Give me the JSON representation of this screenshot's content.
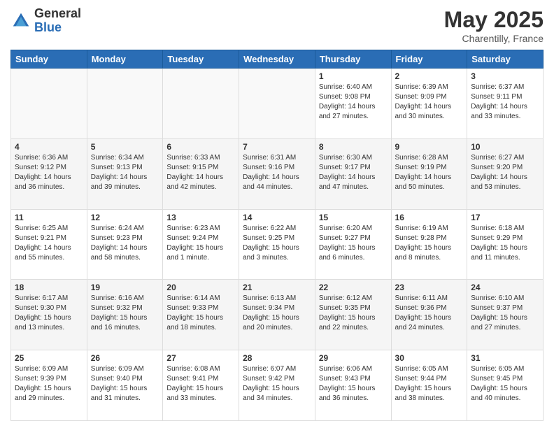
{
  "header": {
    "logo_general": "General",
    "logo_blue": "Blue",
    "month_year": "May 2025",
    "location": "Charentilly, France"
  },
  "days_of_week": [
    "Sunday",
    "Monday",
    "Tuesday",
    "Wednesday",
    "Thursday",
    "Friday",
    "Saturday"
  ],
  "weeks": [
    {
      "row_class": "row-odd",
      "days": [
        {
          "num": "",
          "empty": true
        },
        {
          "num": "",
          "empty": true
        },
        {
          "num": "",
          "empty": true
        },
        {
          "num": "",
          "empty": true
        },
        {
          "num": "1",
          "sunrise": "6:40 AM",
          "sunset": "9:08 PM",
          "daylight": "14 hours and 27 minutes."
        },
        {
          "num": "2",
          "sunrise": "6:39 AM",
          "sunset": "9:09 PM",
          "daylight": "14 hours and 30 minutes."
        },
        {
          "num": "3",
          "sunrise": "6:37 AM",
          "sunset": "9:11 PM",
          "daylight": "14 hours and 33 minutes."
        }
      ]
    },
    {
      "row_class": "row-even",
      "days": [
        {
          "num": "4",
          "sunrise": "6:36 AM",
          "sunset": "9:12 PM",
          "daylight": "14 hours and 36 minutes."
        },
        {
          "num": "5",
          "sunrise": "6:34 AM",
          "sunset": "9:13 PM",
          "daylight": "14 hours and 39 minutes."
        },
        {
          "num": "6",
          "sunrise": "6:33 AM",
          "sunset": "9:15 PM",
          "daylight": "14 hours and 42 minutes."
        },
        {
          "num": "7",
          "sunrise": "6:31 AM",
          "sunset": "9:16 PM",
          "daylight": "14 hours and 44 minutes."
        },
        {
          "num": "8",
          "sunrise": "6:30 AM",
          "sunset": "9:17 PM",
          "daylight": "14 hours and 47 minutes."
        },
        {
          "num": "9",
          "sunrise": "6:28 AM",
          "sunset": "9:19 PM",
          "daylight": "14 hours and 50 minutes."
        },
        {
          "num": "10",
          "sunrise": "6:27 AM",
          "sunset": "9:20 PM",
          "daylight": "14 hours and 53 minutes."
        }
      ]
    },
    {
      "row_class": "row-odd",
      "days": [
        {
          "num": "11",
          "sunrise": "6:25 AM",
          "sunset": "9:21 PM",
          "daylight": "14 hours and 55 minutes."
        },
        {
          "num": "12",
          "sunrise": "6:24 AM",
          "sunset": "9:23 PM",
          "daylight": "14 hours and 58 minutes."
        },
        {
          "num": "13",
          "sunrise": "6:23 AM",
          "sunset": "9:24 PM",
          "daylight": "15 hours and 1 minute."
        },
        {
          "num": "14",
          "sunrise": "6:22 AM",
          "sunset": "9:25 PM",
          "daylight": "15 hours and 3 minutes."
        },
        {
          "num": "15",
          "sunrise": "6:20 AM",
          "sunset": "9:27 PM",
          "daylight": "15 hours and 6 minutes."
        },
        {
          "num": "16",
          "sunrise": "6:19 AM",
          "sunset": "9:28 PM",
          "daylight": "15 hours and 8 minutes."
        },
        {
          "num": "17",
          "sunrise": "6:18 AM",
          "sunset": "9:29 PM",
          "daylight": "15 hours and 11 minutes."
        }
      ]
    },
    {
      "row_class": "row-even",
      "days": [
        {
          "num": "18",
          "sunrise": "6:17 AM",
          "sunset": "9:30 PM",
          "daylight": "15 hours and 13 minutes."
        },
        {
          "num": "19",
          "sunrise": "6:16 AM",
          "sunset": "9:32 PM",
          "daylight": "15 hours and 16 minutes."
        },
        {
          "num": "20",
          "sunrise": "6:14 AM",
          "sunset": "9:33 PM",
          "daylight": "15 hours and 18 minutes."
        },
        {
          "num": "21",
          "sunrise": "6:13 AM",
          "sunset": "9:34 PM",
          "daylight": "15 hours and 20 minutes."
        },
        {
          "num": "22",
          "sunrise": "6:12 AM",
          "sunset": "9:35 PM",
          "daylight": "15 hours and 22 minutes."
        },
        {
          "num": "23",
          "sunrise": "6:11 AM",
          "sunset": "9:36 PM",
          "daylight": "15 hours and 24 minutes."
        },
        {
          "num": "24",
          "sunrise": "6:10 AM",
          "sunset": "9:37 PM",
          "daylight": "15 hours and 27 minutes."
        }
      ]
    },
    {
      "row_class": "row-odd",
      "days": [
        {
          "num": "25",
          "sunrise": "6:09 AM",
          "sunset": "9:39 PM",
          "daylight": "15 hours and 29 minutes."
        },
        {
          "num": "26",
          "sunrise": "6:09 AM",
          "sunset": "9:40 PM",
          "daylight": "15 hours and 31 minutes."
        },
        {
          "num": "27",
          "sunrise": "6:08 AM",
          "sunset": "9:41 PM",
          "daylight": "15 hours and 33 minutes."
        },
        {
          "num": "28",
          "sunrise": "6:07 AM",
          "sunset": "9:42 PM",
          "daylight": "15 hours and 34 minutes."
        },
        {
          "num": "29",
          "sunrise": "6:06 AM",
          "sunset": "9:43 PM",
          "daylight": "15 hours and 36 minutes."
        },
        {
          "num": "30",
          "sunrise": "6:05 AM",
          "sunset": "9:44 PM",
          "daylight": "15 hours and 38 minutes."
        },
        {
          "num": "31",
          "sunrise": "6:05 AM",
          "sunset": "9:45 PM",
          "daylight": "15 hours and 40 minutes."
        }
      ]
    }
  ]
}
